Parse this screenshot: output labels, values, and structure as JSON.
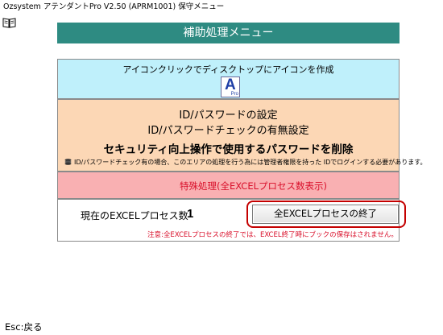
{
  "window": {
    "title": "Ozsystem アテンダントPro V2.50 (APRM1001) 保守メニュー"
  },
  "header": {
    "title": "補助処理メニュー"
  },
  "icon_panel": {
    "label": "アイコンクリックでディスクトップにアイコンを作成",
    "icon_letter": "A",
    "icon_sub": "Pro"
  },
  "password_panel": {
    "line1": "ID/パスワードの設定",
    "line2": "ID/パスワードチェックの有無設定",
    "line3": "セキュリティ向上操作で使用するパスワードを削除",
    "note": "ID/パスワードチェック有の場合、このエリアの処理を行う為には管理者権限を持った IDでログインする必要があります。"
  },
  "special_panel": {
    "label": "特殊処理(全EXCELプロセス数表示)"
  },
  "process_panel": {
    "label": "現在のEXCELプロセス数",
    "count": "1",
    "end_button": "全EXCELプロセスの終了",
    "warning": "注意:全EXCELプロセスの終了では、EXCEL終了時にブックの保存はされません。"
  },
  "footer": {
    "esc_label": "Esc:戻る"
  },
  "colors": {
    "header_bg": "#2e8b82",
    "icon_panel_bg": "#bff0fb",
    "password_panel_bg": "#fcd7b5",
    "special_panel_bg": "#f9b0b2",
    "accent_red": "#d90f2a",
    "highlight_ring": "#c40000"
  },
  "icons": [
    "book-icon",
    "app-shortcut-icon",
    "stack-icon"
  ]
}
